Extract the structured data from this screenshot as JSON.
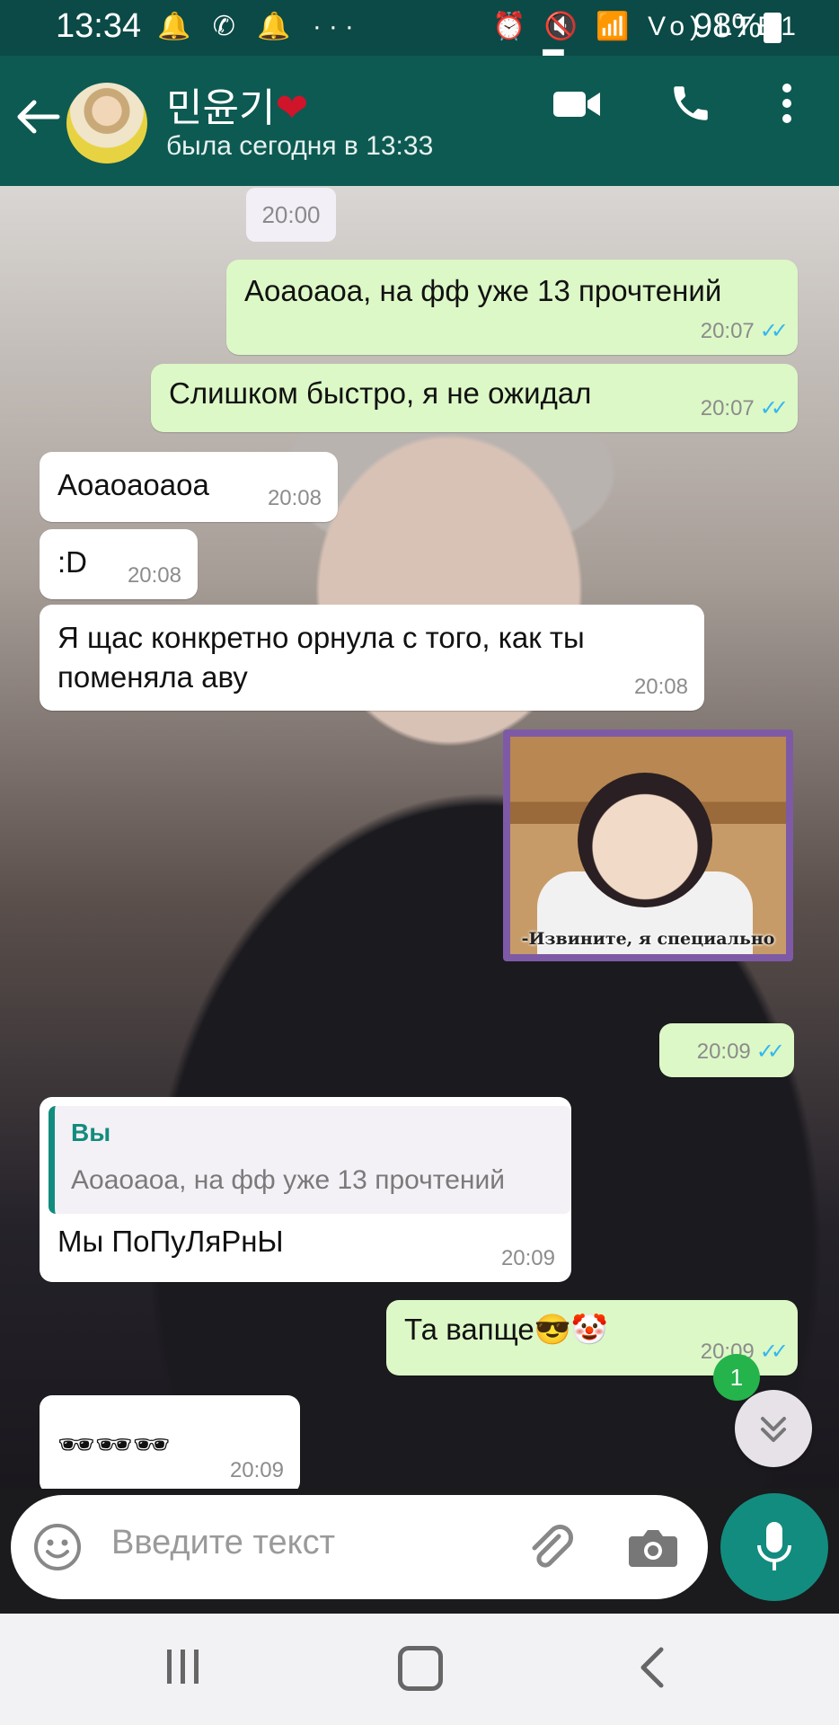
{
  "status_bar": {
    "time": "13:34",
    "left_icons": "🔔 ✆ 🔔 ···",
    "right_icons": "⏰ 🔇 📶 Vo) LTE1 ▂▄▆",
    "battery": "98%"
  },
  "header": {
    "contact_name": "민윤기",
    "heart": "❤",
    "last_seen": "была сегодня в 13:33"
  },
  "chat": {
    "date_chip": "20:00",
    "messages": [
      {
        "dir": "out",
        "text": "Аоаоаоа, на фф уже 13 прочтений",
        "time": "20:07",
        "ticks": "✓✓"
      },
      {
        "dir": "out",
        "text": "Слишком быстро, я не ожидал",
        "time": "20:07",
        "ticks": "✓✓"
      },
      {
        "dir": "in",
        "text": "Аоаоаоаоа",
        "time": "20:08"
      },
      {
        "dir": "in",
        "text": ":D",
        "time": "20:08"
      },
      {
        "dir": "in",
        "text_line1": "Я щас конкретно орнула с того, как ты",
        "text_line2": "поменяла аву",
        "time": "20:08"
      },
      {
        "dir": "out",
        "type": "image",
        "caption": "-Извините, я специально",
        "time": "20:09",
        "ticks": "✓✓"
      },
      {
        "dir": "in",
        "quote_author": "Вы",
        "quote_text": "Аоаоаоа, на фф уже 13 прочтений",
        "text": "Мы ПоПуЛяРнЫ",
        "time": "20:09"
      },
      {
        "dir": "out",
        "text": "Та вапще😎🤡",
        "time": "20:09",
        "ticks": "✓✓"
      },
      {
        "dir": "in",
        "text": "🕶🕶🕶",
        "time": "20:09"
      }
    ],
    "unread_badge": "1"
  },
  "input": {
    "placeholder": "Введите текст"
  },
  "colors": {
    "header_bg": "#0d5a52",
    "outgoing_bubble": "#dcf8c6",
    "incoming_bubble": "#ffffff",
    "mic_button": "#128c7e",
    "read_ticks": "#34b7f1",
    "unread_badge": "#25b34b"
  },
  "icons": [
    "back-arrow-icon",
    "video-call-icon",
    "phone-icon",
    "more-vert-icon",
    "emoji-icon",
    "attach-icon",
    "camera-icon",
    "mic-icon",
    "scroll-down-icon",
    "nav-recent-icon",
    "nav-home-icon",
    "nav-back-icon"
  ]
}
